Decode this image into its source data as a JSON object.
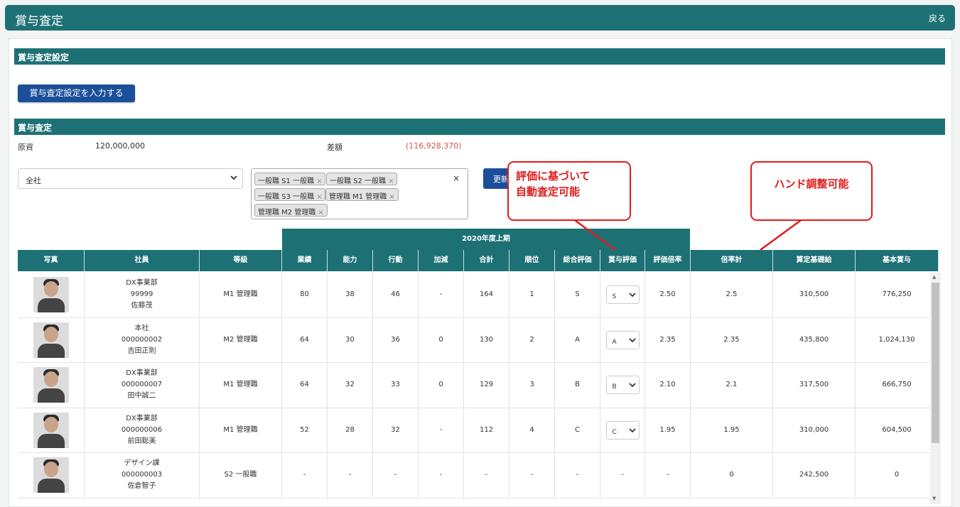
{
  "header": {
    "title": "賞与査定",
    "back_label": "戻る"
  },
  "settings_section": {
    "title": "賞与査定設定",
    "button_label": "賞与査定設定を入力する"
  },
  "assessment_section": {
    "title": "賞与査定"
  },
  "summary": {
    "gen_label": "原資",
    "gen_value": "120,000,000",
    "diff_label": "差額",
    "diff_value": "(116,928,370)"
  },
  "filters": {
    "department": "全社",
    "tags": [
      "一般職 S1 一般職",
      "一般職 S2 一般職",
      "一般職 S3 一般職",
      "管理職 M1 管理職",
      "管理職 M2 管理職"
    ],
    "tag_remove": "×",
    "clear": "×",
    "update_label": "更新"
  },
  "callouts": {
    "auto": "評価に基づいて\n自動査定可能",
    "hand": "ハンド調整可能"
  },
  "table": {
    "period": "2020年度上期",
    "columns": [
      "写真",
      "社員",
      "等級",
      "業績",
      "能力",
      "行動",
      "加減",
      "合計",
      "順位",
      "総合評価",
      "賞与評価",
      "評価倍率",
      "倍率計",
      "算定基礎給",
      "基本賞与"
    ],
    "rows": [
      {
        "dept": "DX事業部",
        "id": "99999",
        "name": "佐藤茂",
        "grade": "M1 管理職",
        "perf": "80",
        "ability": "38",
        "action": "46",
        "adj": "-",
        "total": "164",
        "rank": "1",
        "overall": "S",
        "bonus_eval": "S",
        "rate": "2.50",
        "rate_total": "2.5",
        "base": "310,500",
        "bonus": "776,250"
      },
      {
        "dept": "本社",
        "id": "000000002",
        "name": "吉田正則",
        "grade": "M2 管理職",
        "perf": "64",
        "ability": "30",
        "action": "36",
        "adj": "0",
        "total": "130",
        "rank": "2",
        "overall": "A",
        "bonus_eval": "A",
        "rate": "2.35",
        "rate_total": "2.35",
        "base": "435,800",
        "bonus": "1,024,130"
      },
      {
        "dept": "DX事業部",
        "id": "000000007",
        "name": "田中誠二",
        "grade": "M1 管理職",
        "perf": "64",
        "ability": "32",
        "action": "33",
        "adj": "0",
        "total": "129",
        "rank": "3",
        "overall": "B",
        "bonus_eval": "B",
        "rate": "2.10",
        "rate_total": "2.1",
        "base": "317,500",
        "bonus": "666,750"
      },
      {
        "dept": "DX事業部",
        "id": "000000006",
        "name": "前田聡美",
        "grade": "M1 管理職",
        "perf": "52",
        "ability": "28",
        "action": "32",
        "adj": "-",
        "total": "112",
        "rank": "4",
        "overall": "C",
        "bonus_eval": "C",
        "rate": "1.95",
        "rate_total": "1.95",
        "base": "310,000",
        "bonus": "604,500"
      },
      {
        "dept": "デザイン課",
        "id": "000000003",
        "name": "佐倉智子",
        "grade": "S2 一般職",
        "perf": "-",
        "ability": "-",
        "action": "-",
        "adj": "-",
        "total": "-",
        "rank": "-",
        "overall": "-",
        "bonus_eval": "-",
        "rate": "-",
        "rate_total": "0",
        "base": "242,500",
        "bonus": "0"
      }
    ]
  }
}
